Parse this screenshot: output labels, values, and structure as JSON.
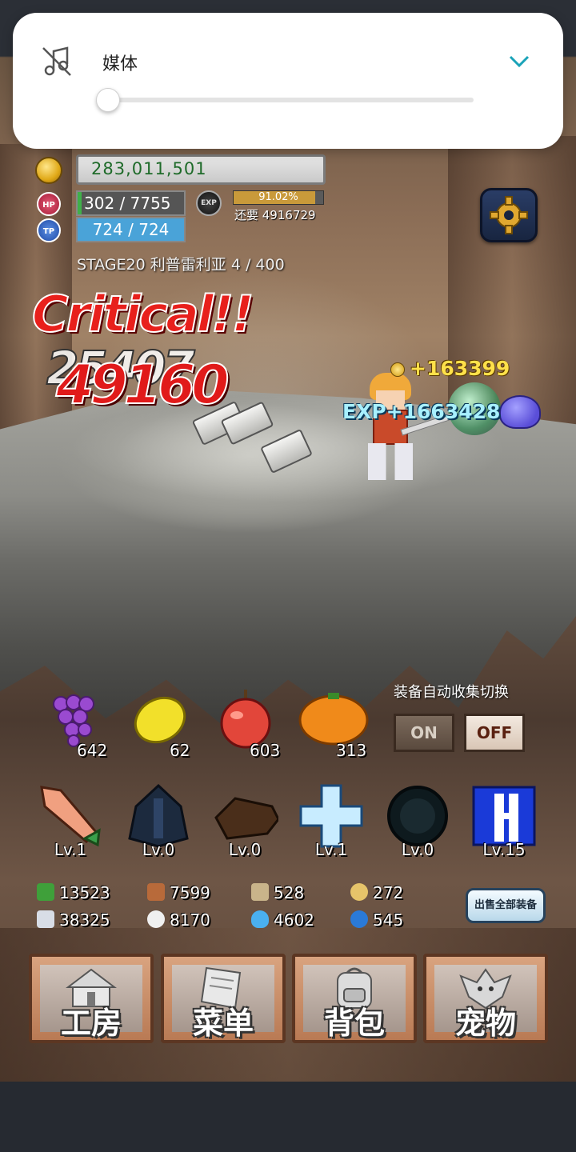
{
  "volume_panel": {
    "label": "媒体",
    "level_percent": 0
  },
  "hud": {
    "gold": "283,011,501",
    "hp_badge": "HP",
    "hp_text": "302 / 7755",
    "hp_ratio": 0.039,
    "tp_badge": "TP",
    "tp_text": "724 / 724",
    "exp_badge": "EXP",
    "exp_percent": "91.02%",
    "exp_ratio": 0.9102,
    "exp_remaining": "还要 4916729",
    "stage": "STAGE20 利普雷利亚 4 / 400"
  },
  "combat": {
    "critical": "Critical!!",
    "damage_ghost": "25407",
    "damage": "49160",
    "gold_gain": "+163399",
    "exp_gain": "EXP+1663428"
  },
  "fruits": [
    {
      "name": "grape",
      "count": "642"
    },
    {
      "name": "lemon",
      "count": "62"
    },
    {
      "name": "apple",
      "count": "603"
    },
    {
      "name": "orange",
      "count": "313"
    }
  ],
  "auto_collect": {
    "title": "装备自动收集切换",
    "on": "ON",
    "off": "OFF"
  },
  "equipment": [
    {
      "name": "sword",
      "level": "Lv.1"
    },
    {
      "name": "armor",
      "level": "Lv.0"
    },
    {
      "name": "glove",
      "level": "Lv.0"
    },
    {
      "name": "cross-shield",
      "level": "Lv.1"
    },
    {
      "name": "ring",
      "level": "Lv.0"
    },
    {
      "name": "accessory",
      "level": "Lv.15"
    }
  ],
  "resources": [
    {
      "icon": "herb-icon",
      "value": "13523",
      "color": "#3fa03a"
    },
    {
      "icon": "wood-icon",
      "value": "7599",
      "color": "#b86a3a"
    },
    {
      "icon": "branch-icon",
      "value": "528",
      "color": "#c9b48a"
    },
    {
      "icon": "oil-drop-icon",
      "value": "272",
      "color": "#e6c46a"
    },
    {
      "icon": "iron-ingot-icon",
      "value": "38325",
      "color": "#d8dde6"
    },
    {
      "icon": "cotton-icon",
      "value": "8170",
      "color": "#f0f0f0"
    },
    {
      "icon": "flame-icon",
      "value": "4602",
      "color": "#4ab0f0"
    },
    {
      "icon": "gem-icon",
      "value": "545",
      "color": "#2a7ad8"
    }
  ],
  "sell_all": "出售全部装备",
  "menu": [
    {
      "name": "workshop",
      "label": "工房"
    },
    {
      "name": "menu",
      "label": "菜单"
    },
    {
      "name": "backpack",
      "label": "背包"
    },
    {
      "name": "pet",
      "label": "宠物"
    }
  ],
  "colors": {
    "panel": "#ffffff",
    "accent": "#1aa3b8",
    "damage": "#e11a1a",
    "gold_text": "#1f6b2a"
  }
}
